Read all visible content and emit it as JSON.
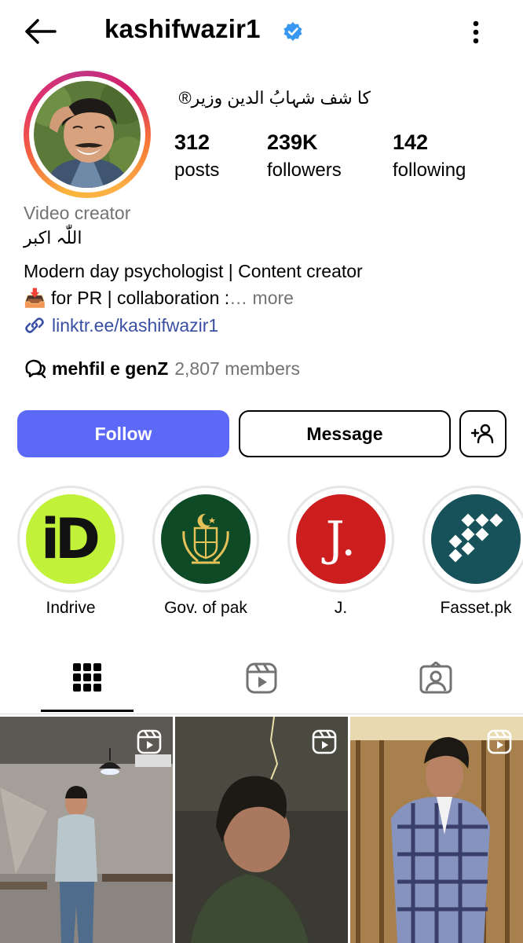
{
  "header": {
    "username": "kashifwazir1",
    "back_icon": "arrow-left-icon",
    "verified_icon": "verified-badge-icon",
    "more_icon": "more-vertical-icon"
  },
  "profile": {
    "full_name": "کا شف شہابُ الدین وزیر®",
    "stats": [
      {
        "value": "312",
        "label": "posts"
      },
      {
        "value": "239K",
        "label": "followers"
      },
      {
        "value": "142",
        "label": "following"
      }
    ],
    "category": "Video creator",
    "arabic_line": "اللّٰہ اکبر",
    "bio_line1": "Modern day psychologist | Content creator",
    "bio_line2_emoji": "📥",
    "bio_line2": " for PR | collaboration :",
    "bio_more": "… more",
    "link": "linktr.ee/kashifwazir1",
    "channel_name": "mehfil e genZ",
    "channel_members": "2,807 members"
  },
  "actions": {
    "follow": "Follow",
    "message": "Message",
    "add_user_icon": "add-person-icon"
  },
  "highlights": [
    {
      "label": "Indrive"
    },
    {
      "label": "Gov. of pak"
    },
    {
      "label": "J."
    },
    {
      "label": "Fasset.pk"
    }
  ],
  "highlight_logo_text": {
    "indrive": "iD",
    "j": "J."
  },
  "tabs": [
    {
      "icon": "grid-icon"
    },
    {
      "icon": "reels-icon"
    },
    {
      "icon": "tagged-icon"
    }
  ],
  "colors": {
    "follow_button": "#5b69f6",
    "link": "#3a4fa4",
    "verified": "#3897f0",
    "secondary_text": "#737373"
  }
}
